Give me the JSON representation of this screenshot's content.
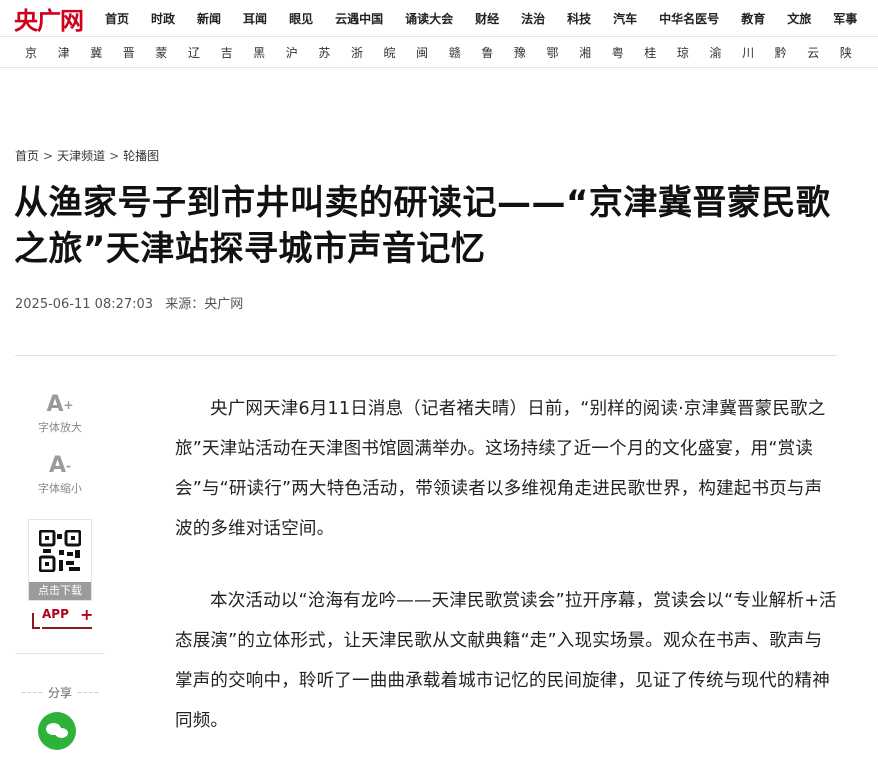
{
  "brand": {
    "logo_text": "央广网"
  },
  "nav": {
    "items": [
      "首页",
      "时政",
      "新闻",
      "耳闻",
      "眼见",
      "云遇中国",
      "诵读大会",
      "财经",
      "法治",
      "科技",
      "汽车",
      "中华名医号",
      "教育",
      "文旅",
      "军事"
    ]
  },
  "provinces": {
    "items": [
      "京",
      "津",
      "冀",
      "晋",
      "蒙",
      "辽",
      "吉",
      "黑",
      "沪",
      "苏",
      "浙",
      "皖",
      "闽",
      "赣",
      "鲁",
      "豫",
      "鄂",
      "湘",
      "粤",
      "桂",
      "琼",
      "渝",
      "川",
      "黔",
      "云",
      "陕"
    ]
  },
  "breadcrumb": {
    "home": "首页",
    "channel": "天津频道",
    "section": "轮播图",
    "separator": ">"
  },
  "article": {
    "title": "从渔家号子到市井叫卖的研读记——“京津冀晋蒙民歌之旅”天津站探寻城市声音记忆",
    "date": "2025-06-11 08:27:03",
    "source": "来源：央广网",
    "paragraphs": [
      "央广网天津6月11日消息（记者褚夫晴）日前，“别样的阅读·京津冀晋蒙民歌之旅”天津站活动在天津图书馆圆满举办。这场持续了近一个月的文化盛宴，用“赏读会”与“研读行”两大特色活动，带领读者以多维视角走进民歌世界，构建起书页与声波的多维对话空间。",
      "本次活动以“沧海有龙吟——天津民歌赏读会”拉开序幕，赏读会以“专业解析+活态展演”的立体形式，让天津民歌从文献典籍“走”入现实场景。观众在书声、歌声与掌声的交响中，聆听了一曲曲承载着城市记忆的民间旋律，见证了传统与现代的精神同频。"
    ]
  },
  "tools": {
    "font_up_glyph": "A",
    "font_up_sign": "+",
    "font_up_label": "字体放大",
    "font_down_glyph": "A",
    "font_down_sign": "-",
    "font_down_label": "字体缩小",
    "download_label": "点击下载",
    "app_label": "APP",
    "app_plus": "+",
    "share_label": "分享"
  },
  "colors": {
    "brand_red": "#d0001b",
    "wechat_green": "#2fb23a"
  },
  "icons": [
    "qr-code-icon",
    "wechat-icon"
  ]
}
